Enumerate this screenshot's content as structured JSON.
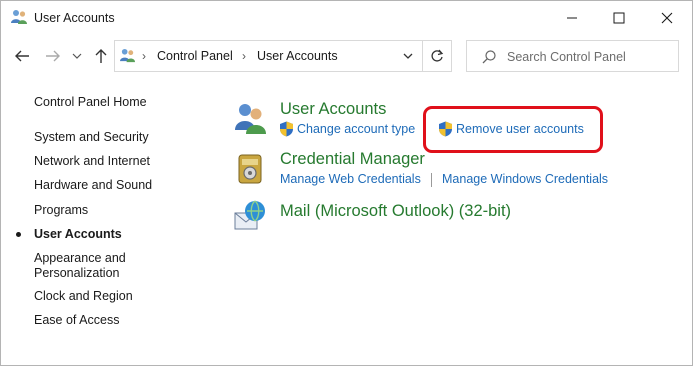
{
  "window": {
    "title": "User Accounts"
  },
  "address": {
    "crumbs": [
      "Control Panel",
      "User Accounts"
    ]
  },
  "search": {
    "placeholder": "Search Control Panel"
  },
  "sidebar": {
    "items": [
      {
        "label": "Control Panel Home"
      },
      {
        "label": "System and Security"
      },
      {
        "label": "Network and Internet"
      },
      {
        "label": "Hardware and Sound"
      },
      {
        "label": "Programs"
      },
      {
        "label": "User Accounts",
        "active": true
      },
      {
        "label": "Appearance and\nPersonalization"
      },
      {
        "label": "Clock and Region"
      },
      {
        "label": "Ease of Access"
      }
    ]
  },
  "categories": [
    {
      "title": "User Accounts",
      "icon": "user-accounts-icon",
      "tasks": [
        "Change account type",
        "Remove user accounts"
      ]
    },
    {
      "title": "Credential Manager",
      "icon": "credential-manager-icon",
      "tasks": [
        "Manage Web Credentials",
        "Manage Windows Credentials"
      ]
    },
    {
      "title": "Mail (Microsoft Outlook) (32-bit)",
      "icon": "mail-icon",
      "tasks": []
    }
  ],
  "colors": {
    "category_title": "#267a2f",
    "task_link": "#1e6bb8",
    "highlight": "#e0101a"
  }
}
